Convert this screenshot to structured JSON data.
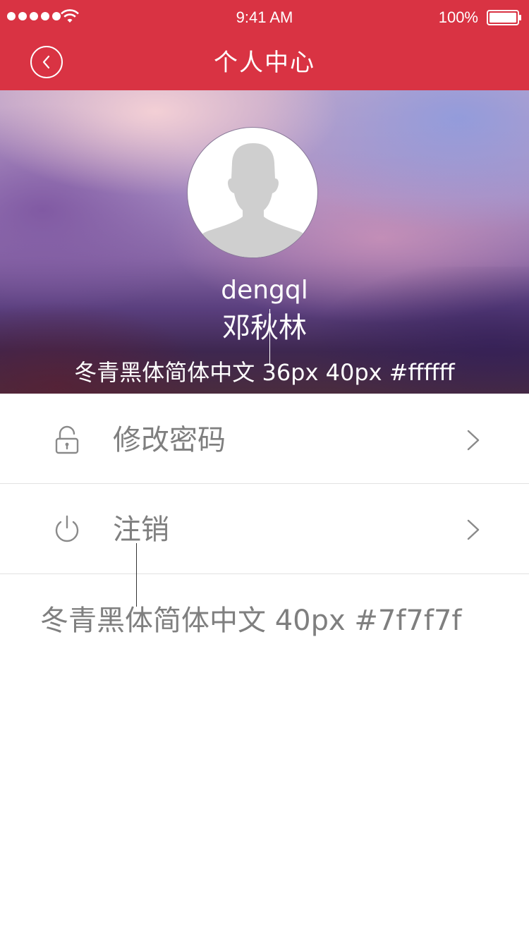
{
  "status_bar": {
    "time": "9:41 AM",
    "battery_percent": "100%",
    "signal_dots": 5,
    "icons": [
      "signal-dots-icon",
      "wifi-icon",
      "battery-icon"
    ]
  },
  "nav": {
    "title": "个人中心",
    "back_icon": "chevron-left-circle-icon",
    "background_color": "#d93343"
  },
  "profile": {
    "username": "dengql",
    "real_name": "邓秋林",
    "avatar_icon": "default-avatar-silhouette",
    "annotation": "冬青黑体简体中文 36px 40px #ffffff"
  },
  "menu": [
    {
      "label": "修改密码",
      "icon": "lock-icon",
      "chevron": "chevron-right-icon"
    },
    {
      "label": "注销",
      "icon": "power-icon",
      "chevron": "chevron-right-icon"
    }
  ],
  "footer_annotation": "冬青黑体简体中文 40px #7f7f7f",
  "colors": {
    "accent": "#d93343",
    "menu_text": "#7f7f7f",
    "divider": "#e2e2e2",
    "hero_text": "#ffffff"
  }
}
